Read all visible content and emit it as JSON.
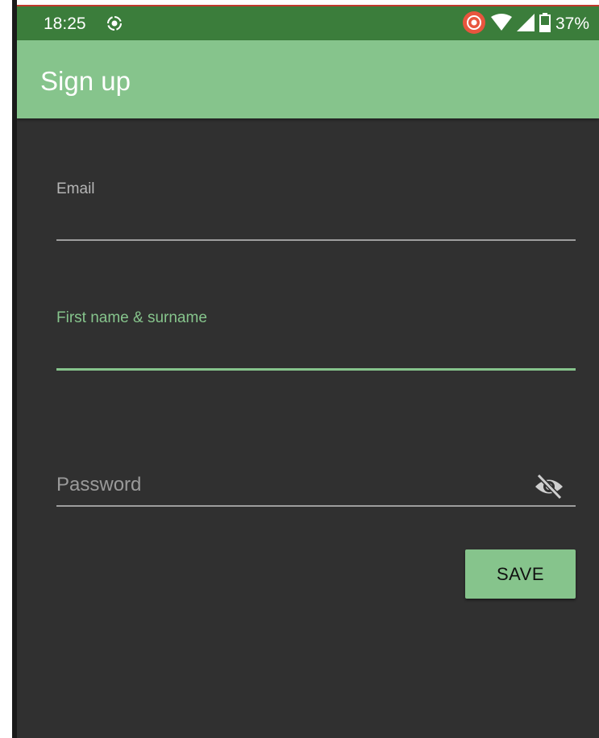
{
  "status_bar": {
    "time": "18:25",
    "battery_percent": "37%",
    "icons": [
      "screen-record-icon",
      "cast-icon",
      "wifi-icon",
      "cell-signal-icon",
      "battery-icon"
    ]
  },
  "app_bar": {
    "title": "Sign up",
    "color": "#86c48c"
  },
  "form": {
    "email": {
      "label": "Email",
      "value": "",
      "placeholder": ""
    },
    "name": {
      "label": "First name & surname",
      "value": "",
      "placeholder": ""
    },
    "password": {
      "label": "Password",
      "value": "",
      "placeholder": "Password",
      "visibility_icon": "eye-off-icon"
    },
    "save_label": "SAVE"
  },
  "colors": {
    "status_bar": "#3b7d3b",
    "accent": "#86c48c",
    "background": "#303030"
  }
}
